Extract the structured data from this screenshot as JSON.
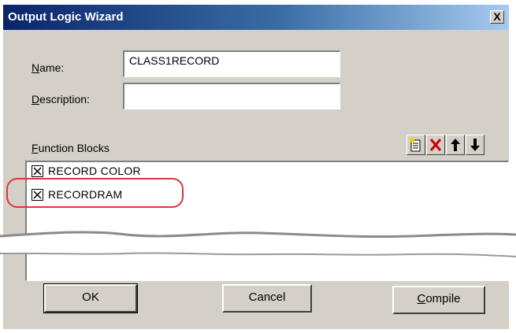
{
  "window": {
    "title": "Output Logic Wizard",
    "close_label": "X"
  },
  "form": {
    "name_label_accel": "N",
    "name_label_rest": "ame:",
    "name_value": "CLASS1RECORD",
    "description_label_accel": "D",
    "description_label_rest": "escription:",
    "description_value": ""
  },
  "function_blocks": {
    "label_accel": "F",
    "label_rest": "unction Blocks",
    "toolbar": [
      "new-block-icon",
      "delete-block-icon",
      "move-up-arrow-icon",
      "move-down-arrow-icon"
    ],
    "items": [
      {
        "label": "RECORD COLOR",
        "checked": true
      },
      {
        "label": "RECORDRAM",
        "checked": true,
        "highlighted": true
      }
    ]
  },
  "buttons": {
    "ok": "OK",
    "cancel": "Cancel",
    "compile_accel": "C",
    "compile_rest": "ompile"
  },
  "colors": {
    "titlebar_start": "#0a246a",
    "titlebar_end": "#a6caf0",
    "dialog_face": "#d4d0c8",
    "annotation_red": "#d43a3a",
    "delete_red": "#d00000"
  }
}
